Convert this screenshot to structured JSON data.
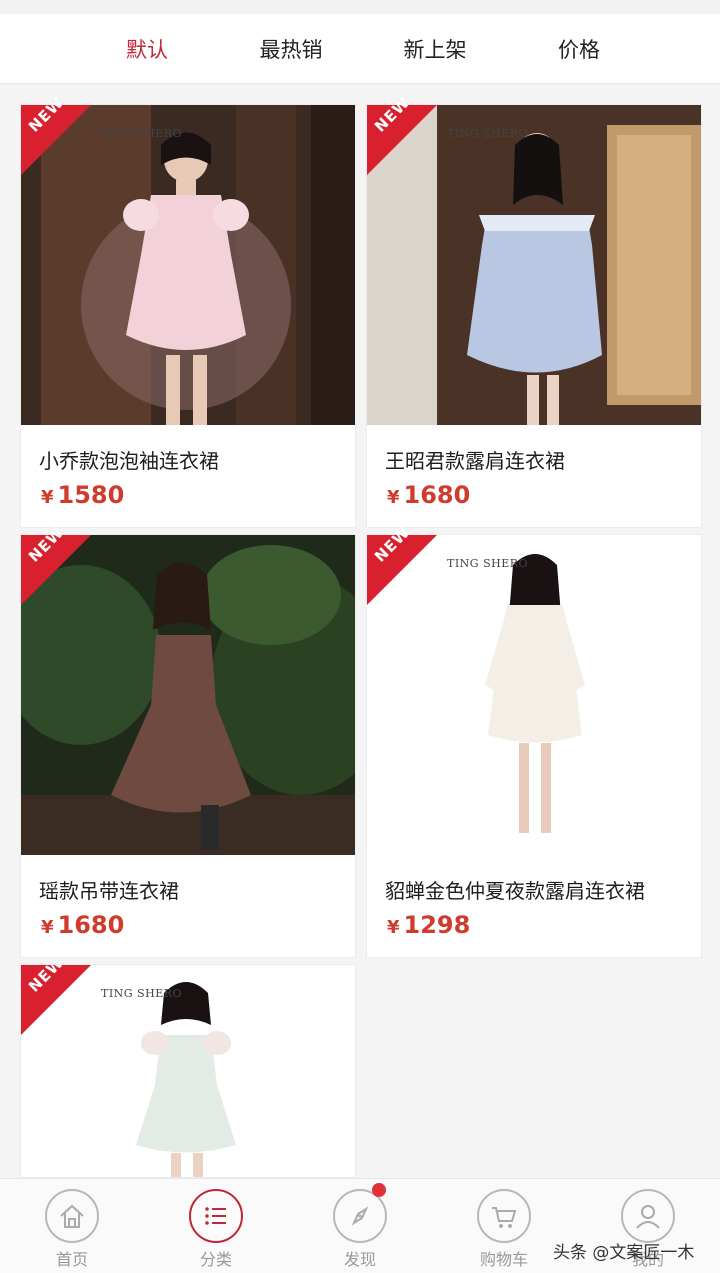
{
  "sort_tabs": [
    {
      "label": "默认",
      "active": true
    },
    {
      "label": "最热销",
      "active": false
    },
    {
      "label": "新上架",
      "active": false
    },
    {
      "label": "价格",
      "active": false
    }
  ],
  "badge_label": "NEW",
  "brand_text": "TING SHERO",
  "currency_symbol": "¥",
  "products": [
    {
      "name": "小乔款泡泡袖连衣裙",
      "price": "1580"
    },
    {
      "name": "王昭君款露肩连衣裙",
      "price": "1680"
    },
    {
      "name": "瑶款吊带连衣裙",
      "price": "1680"
    },
    {
      "name": "貂蝉金色仲夏夜款露肩连衣裙",
      "price": "1298"
    },
    {
      "name": "",
      "price": ""
    }
  ],
  "bottom_nav": [
    {
      "label": "首页",
      "icon": "home-icon"
    },
    {
      "label": "分类",
      "icon": "list-icon"
    },
    {
      "label": "发现",
      "icon": "compass-icon"
    },
    {
      "label": "购物车",
      "icon": "cart-icon"
    },
    {
      "label": "我的",
      "icon": "user-icon"
    }
  ],
  "watermark": "头条 @文案匠一木",
  "colors": {
    "accent": "#c0283a",
    "price": "#cf3b2d",
    "badge": "#d9202e"
  }
}
